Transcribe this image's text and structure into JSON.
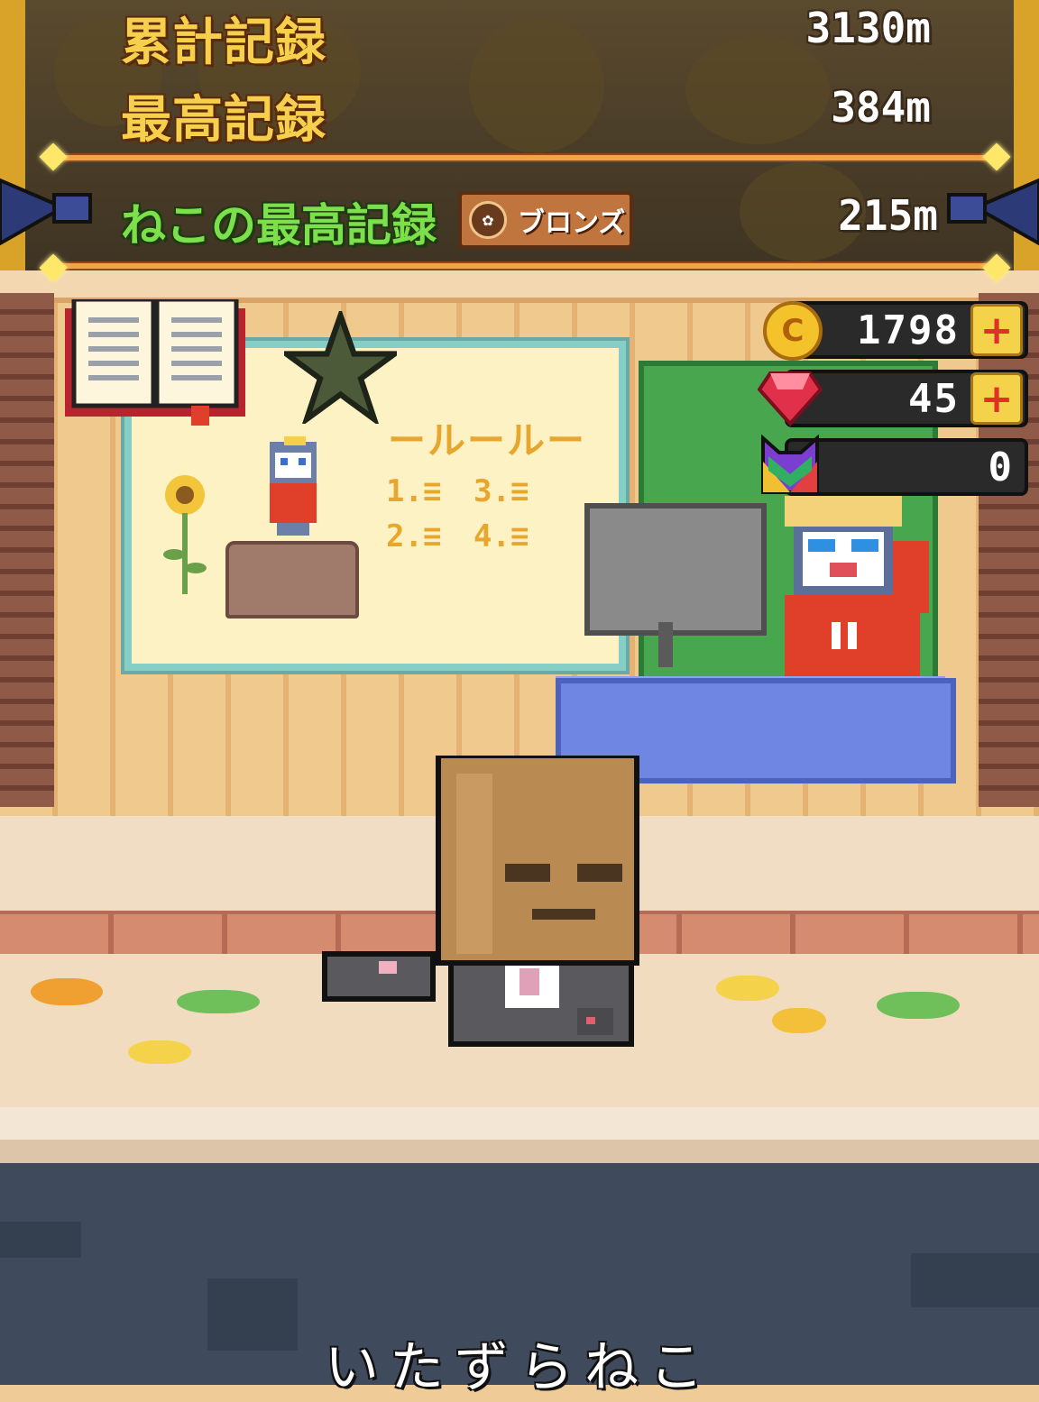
{
  "records": {
    "total_label": "累計記録",
    "total_value": "3130m",
    "best_label": "最高記録",
    "best_value": "384m",
    "cat_best_label": "ねこの最高記録",
    "cat_best_badge": "ブロンズ",
    "cat_best_value": "215m"
  },
  "currency": {
    "coins": "1798",
    "gems": "45",
    "tickets": "0"
  },
  "poster": {
    "title": "ールールー",
    "rule_1": "1.≡",
    "rule_2": "2.≡",
    "rule_3": "3.≡",
    "rule_4": "4.≡"
  },
  "caption": "いたずらねこ",
  "colors": {
    "record_label": "#f6d04d",
    "cat_record_label": "#7ce04c",
    "coin": "#f4c22b",
    "gem": "#e0304a",
    "plus": "#e0302a"
  }
}
